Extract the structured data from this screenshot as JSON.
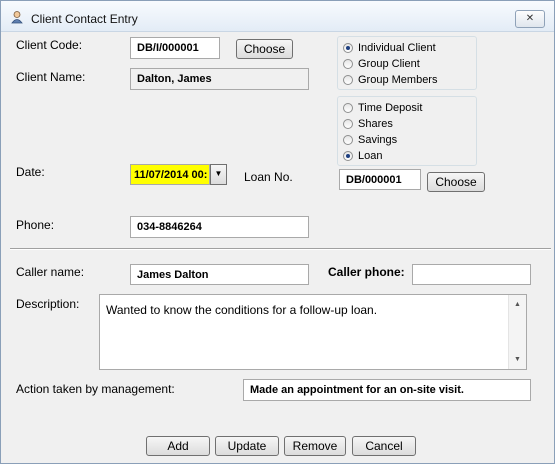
{
  "window": {
    "title": "Client Contact Entry",
    "close_icon": "close-icon",
    "title_icon": "user-icon"
  },
  "client_code": {
    "label": "Client Code:",
    "value": "DB/I/000001",
    "choose_label": "Choose"
  },
  "client_name": {
    "label": "Client Name:",
    "value": "Dalton, James"
  },
  "client_type_options": [
    {
      "label": "Individual Client",
      "selected": true
    },
    {
      "label": "Group Client",
      "selected": false
    },
    {
      "label": "Group Members",
      "selected": false
    }
  ],
  "account_type_options": [
    {
      "label": "Time Deposit",
      "selected": false
    },
    {
      "label": "Shares",
      "selected": false
    },
    {
      "label": "Savings",
      "selected": false
    },
    {
      "label": "Loan",
      "selected": true
    }
  ],
  "date": {
    "label": "Date:",
    "value": "11/07/2014 00:",
    "highlight_color": "#ffff00"
  },
  "loan": {
    "label": "Loan No.",
    "value": "DB/000001",
    "choose_label": "Choose"
  },
  "phone": {
    "label": "Phone:",
    "value": "034-8846264"
  },
  "caller": {
    "name_label": "Caller name:",
    "name_value": "James Dalton",
    "phone_label": "Caller phone:",
    "phone_value": ""
  },
  "description": {
    "label": "Description:",
    "value": "Wanted to know the conditions for a follow-up loan."
  },
  "action": {
    "label": "Action taken by management:",
    "value": "Made an appointment for an on-site visit."
  },
  "buttons": {
    "add": "Add",
    "update": "Update",
    "remove": "Remove",
    "cancel": "Cancel"
  }
}
